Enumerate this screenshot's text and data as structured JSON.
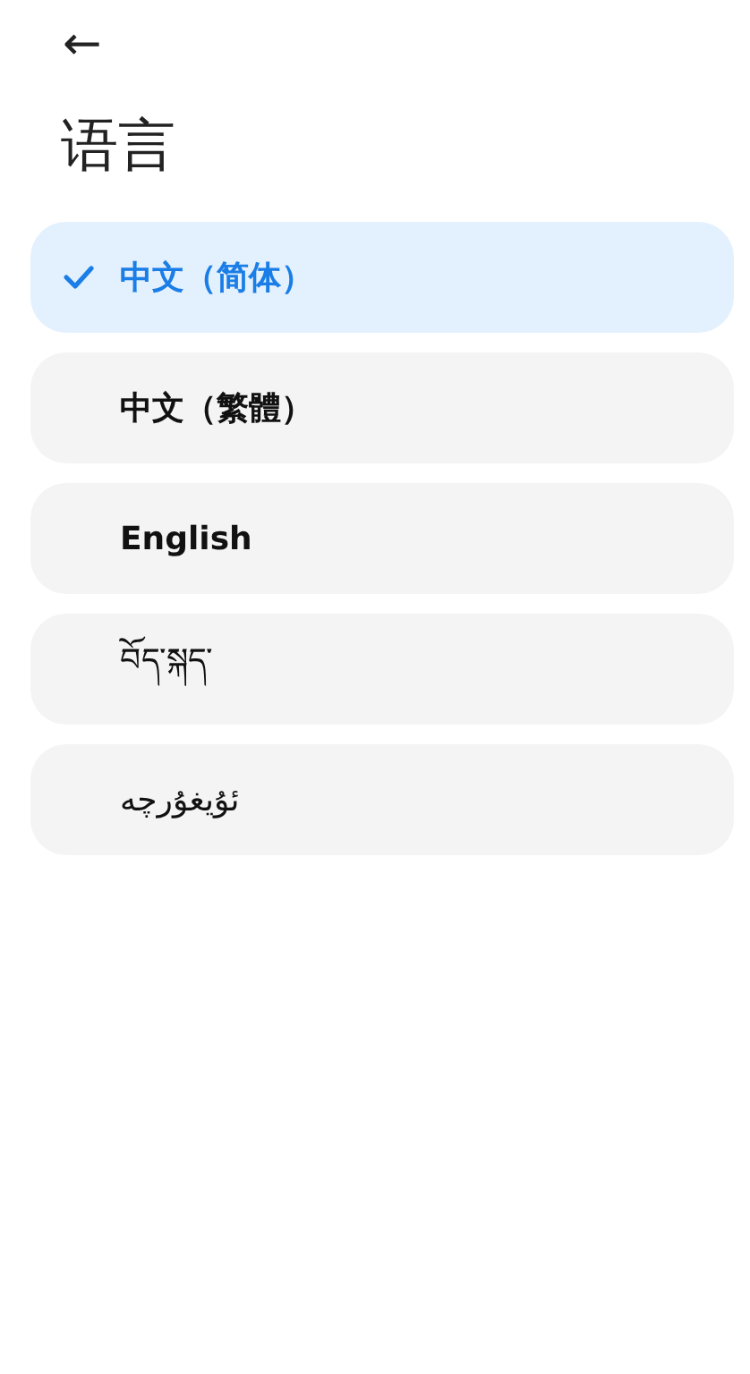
{
  "header": {
    "back": "←",
    "title": "语言"
  },
  "languages": [
    {
      "label": "中文（简体）",
      "selected": true
    },
    {
      "label": "中文（繁體）",
      "selected": false
    },
    {
      "label": "English",
      "selected": false
    },
    {
      "label": "བོད་སྐད་",
      "selected": false
    },
    {
      "label": "ئۇيغۇرچە",
      "selected": false
    }
  ]
}
